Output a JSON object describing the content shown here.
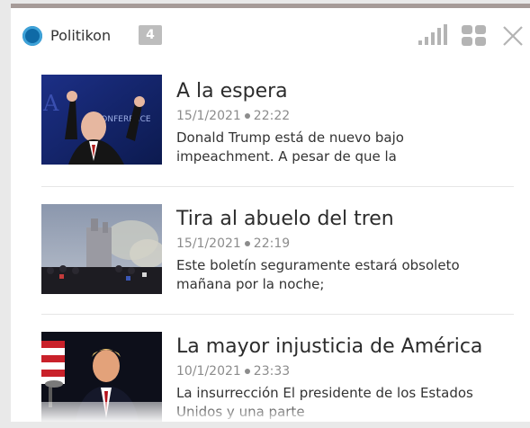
{
  "widget": {
    "brand_name": "Politikon",
    "unread_count": "4",
    "icons": [
      "stats-icon",
      "grid-icon",
      "close-icon"
    ]
  },
  "colors": {
    "brand_blue": "#0f6aa6",
    "badge_gray": "#bdbdbd",
    "top_border": "#a69b98",
    "meta_gray": "#8c8c8c"
  },
  "items": [
    {
      "title": "A la espera",
      "date": "15/1/2021",
      "time": "22:22",
      "excerpt": "Donald Trump está de nuevo bajo impeachment. A pesar de que la",
      "thumbnail": "photo-politician-conference"
    },
    {
      "title": "Tira al abuelo del tren",
      "date": "15/1/2021",
      "time": "22:19",
      "excerpt": "Este boletín seguramente estará obsoleto mañana por la noche;",
      "thumbnail": "photo-capitol-crowd"
    },
    {
      "title": "La mayor injusticia de América",
      "date": "10/1/2021",
      "time": "23:33",
      "excerpt": "La insurrección El presidente de los Estados Unidos y una parte",
      "thumbnail": "photo-president-speech"
    }
  ]
}
